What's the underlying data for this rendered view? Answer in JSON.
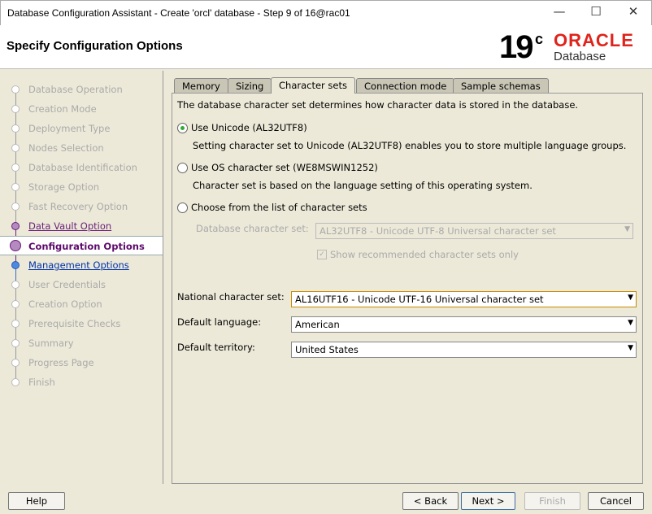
{
  "window": {
    "title": "Database Configuration Assistant - Create 'orcl' database - Step 9 of 16@rac01",
    "min": "—",
    "max": "☐",
    "close": "✕"
  },
  "header": {
    "title": "Specify Configuration Options",
    "logo_version": "19",
    "logo_c": "c",
    "logo_brand": "ORACLE",
    "logo_product": "Database"
  },
  "steps": [
    {
      "label": "Database Operation",
      "state": "done"
    },
    {
      "label": "Creation Mode",
      "state": "done"
    },
    {
      "label": "Deployment Type",
      "state": "done"
    },
    {
      "label": "Nodes Selection",
      "state": "done"
    },
    {
      "label": "Database Identification",
      "state": "done"
    },
    {
      "label": "Storage Option",
      "state": "done"
    },
    {
      "label": "Fast Recovery Option",
      "state": "done"
    },
    {
      "label": "Data Vault Option",
      "state": "visited"
    },
    {
      "label": "Configuration Options",
      "state": "cur"
    },
    {
      "label": "Management Options",
      "state": "next"
    },
    {
      "label": "User Credentials",
      "state": "todo"
    },
    {
      "label": "Creation Option",
      "state": "todo"
    },
    {
      "label": "Prerequisite Checks",
      "state": "todo"
    },
    {
      "label": "Summary",
      "state": "todo"
    },
    {
      "label": "Progress Page",
      "state": "todo"
    },
    {
      "label": "Finish",
      "state": "todo"
    }
  ],
  "tabs": [
    "Memory",
    "Sizing",
    "Character sets",
    "Connection mode",
    "Sample schemas"
  ],
  "content": {
    "intro": "The database character set determines how character data is stored in the database.",
    "opt_unicode": "Use Unicode (AL32UTF8)",
    "opt_unicode_desc": "Setting character set to Unicode (AL32UTF8) enables you to store multiple language groups.",
    "opt_os": "Use OS character set (WE8MSWIN1252)",
    "opt_os_desc": "Character set is based on the language setting of this operating system.",
    "opt_list": "Choose from the list of character sets",
    "db_charset_label": "Database character set:",
    "db_charset_value": "AL32UTF8 - Unicode UTF-8 Universal character set",
    "show_recommended": "Show recommended character sets only",
    "national_label": "National character set:",
    "national_value": "AL16UTF16 - Unicode UTF-16 Universal character set",
    "language_label": "Default language:",
    "language_value": "American",
    "territory_label": "Default territory:",
    "territory_value": "United States"
  },
  "buttons": {
    "help": "Help",
    "back": "< Back",
    "next": "Next >",
    "finish": "Finish",
    "cancel": "Cancel"
  }
}
